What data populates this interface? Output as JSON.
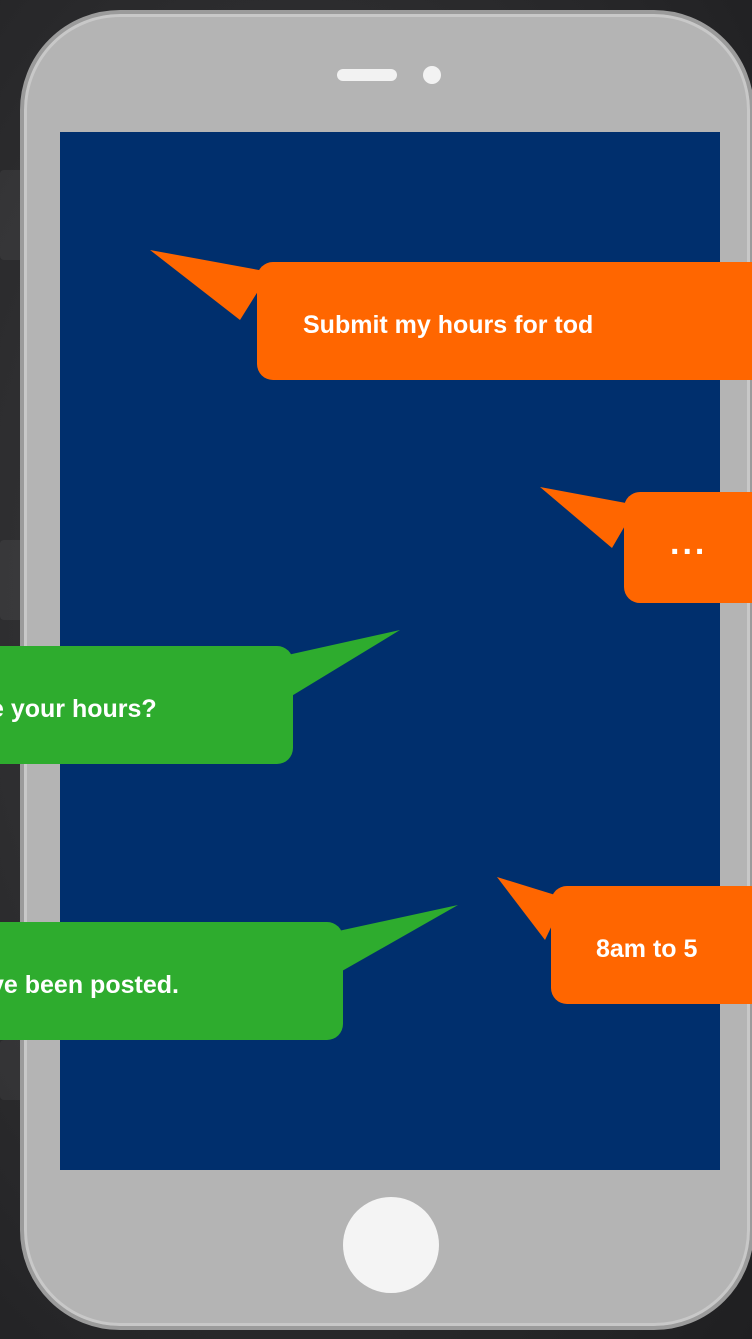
{
  "colors": {
    "screen": "#002f6d",
    "user_bubble": "#ff6600",
    "bot_bubble": "#2eac2e",
    "phone_body": "#b4b4b4"
  },
  "device": {
    "speaker_icon": "speaker-slot",
    "camera_icon": "front-camera",
    "home_button_icon": "home-button"
  },
  "messages": [
    {
      "sender": "user",
      "text": "Submit my hours for tod"
    },
    {
      "sender": "user",
      "text": "..."
    },
    {
      "sender": "bot",
      "text": "e your hours?"
    },
    {
      "sender": "bot",
      "text": "ve been posted."
    },
    {
      "sender": "user",
      "text": "8am to 5"
    }
  ]
}
